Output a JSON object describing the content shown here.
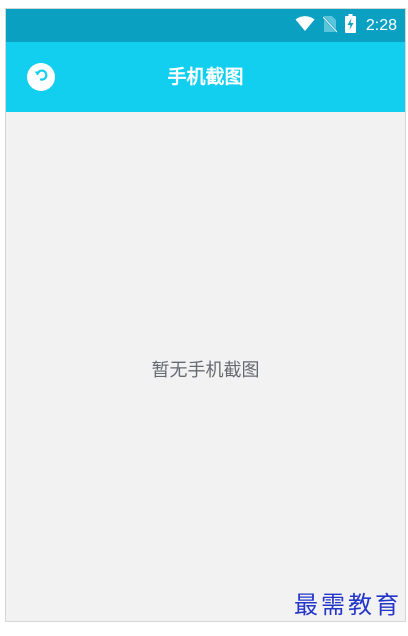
{
  "status_bar": {
    "time": "2:28",
    "icons": [
      "wifi-icon",
      "no-sim-icon",
      "battery-charging-icon"
    ]
  },
  "app_bar": {
    "title": "手机截图",
    "back_icon": "back-arrow-icon"
  },
  "content": {
    "empty_message": "暂无手机截图"
  },
  "watermark": {
    "text": "最需教育"
  },
  "colors": {
    "status_bar": "#0aa0c2",
    "app_bar": "#12cff0",
    "content_bg": "#f2f2f3",
    "empty_text": "#666a70",
    "watermark": "#2436c8"
  }
}
